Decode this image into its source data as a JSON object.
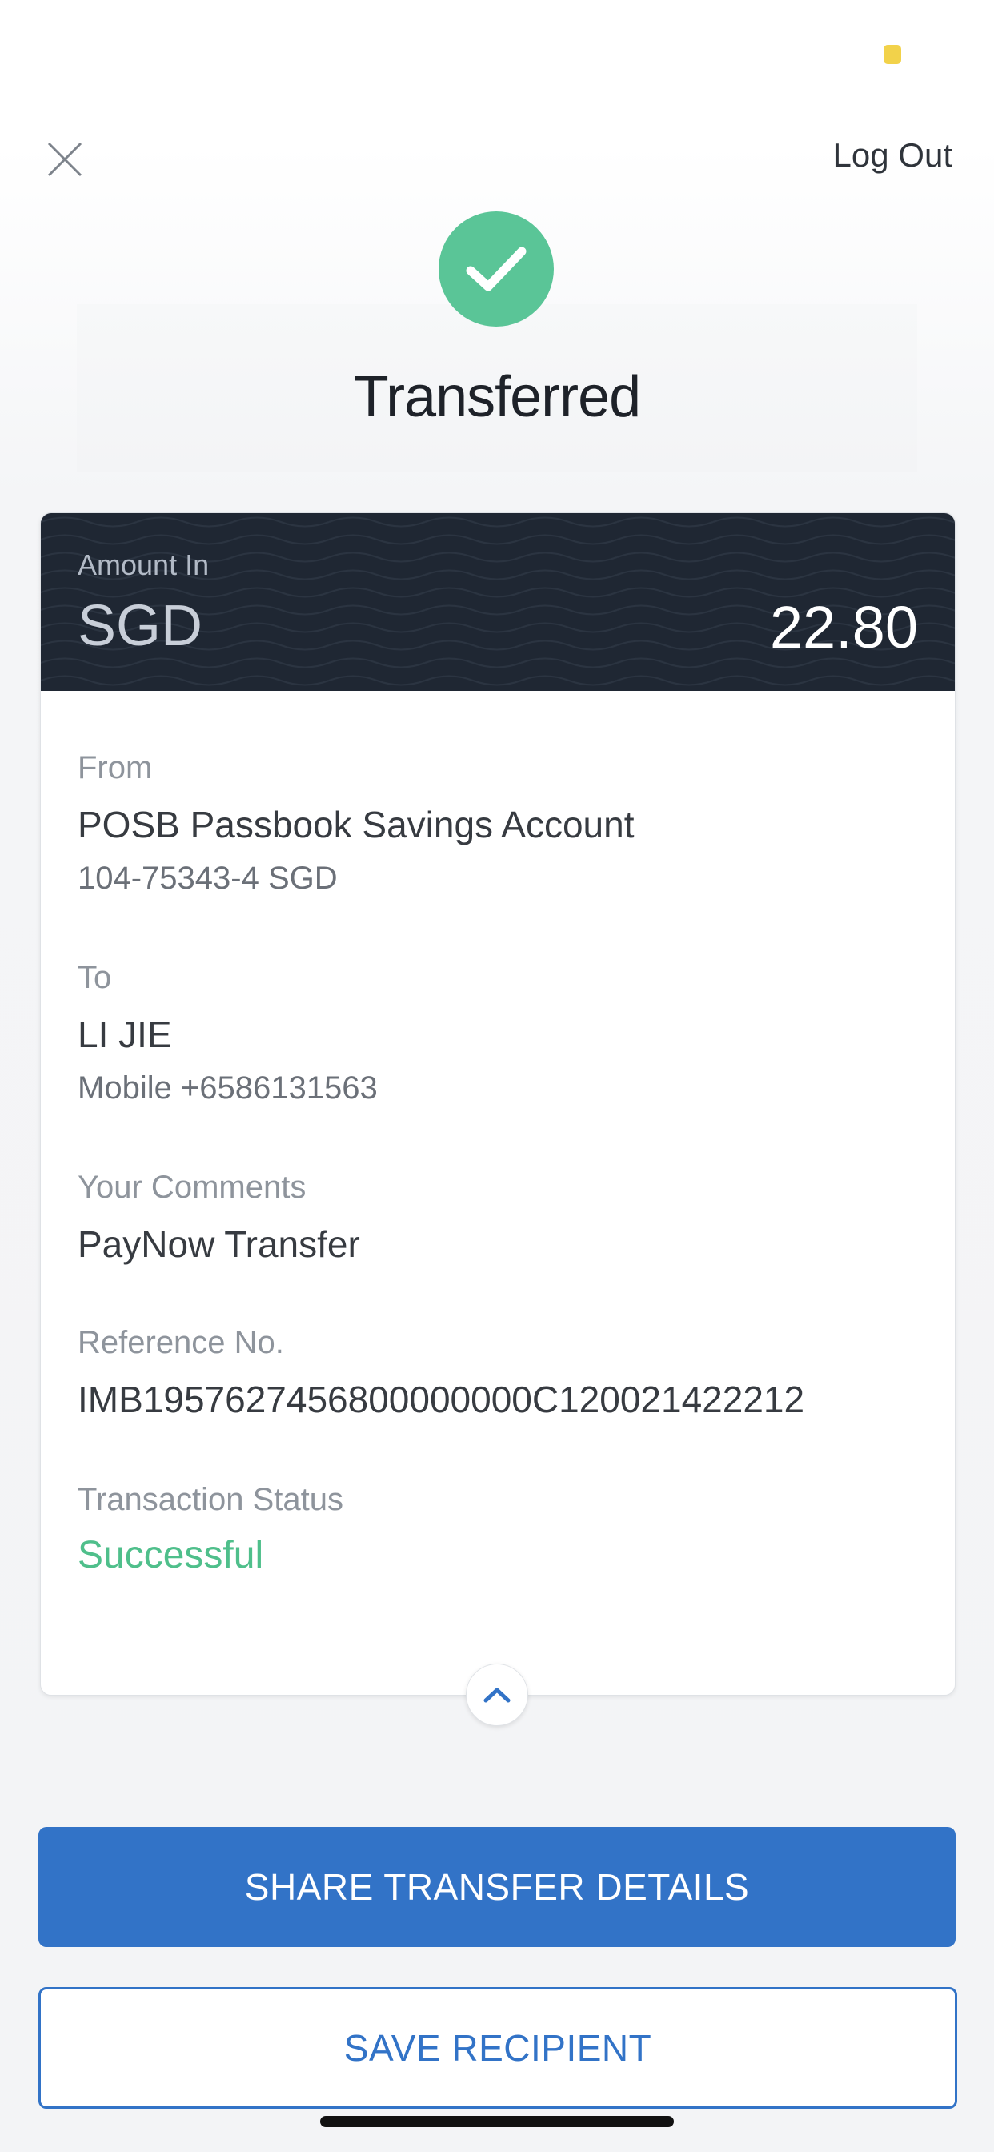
{
  "colors": {
    "success_green": "#5ac597",
    "header_dark": "#1f2733",
    "primary_blue": "#3273c7",
    "status_yellow": "#f2d24a"
  },
  "top_bar": {
    "close_icon": "close-icon",
    "logout_label": "Log Out"
  },
  "header": {
    "icon": "checkmark-icon",
    "title": "Transferred"
  },
  "amount": {
    "label": "Amount In",
    "currency": "SGD",
    "value": "22.80"
  },
  "details": {
    "from": {
      "label": "From",
      "account_name": "POSB Passbook Savings Account",
      "account_number": "104-75343-4 SGD"
    },
    "to": {
      "label": "To",
      "name": "LI JIE",
      "mobile": "Mobile +6586131563"
    },
    "comments": {
      "label": "Your Comments",
      "value": "PayNow Transfer"
    },
    "reference": {
      "label": "Reference No.",
      "value": "IMB1957627456800000000C120021422212"
    },
    "status": {
      "label": "Transaction Status",
      "value": "Successful"
    }
  },
  "actions": {
    "expand_icon": "chevron-up-icon",
    "share_label": "SHARE TRANSFER DETAILS",
    "save_label": "SAVE RECIPIENT"
  }
}
